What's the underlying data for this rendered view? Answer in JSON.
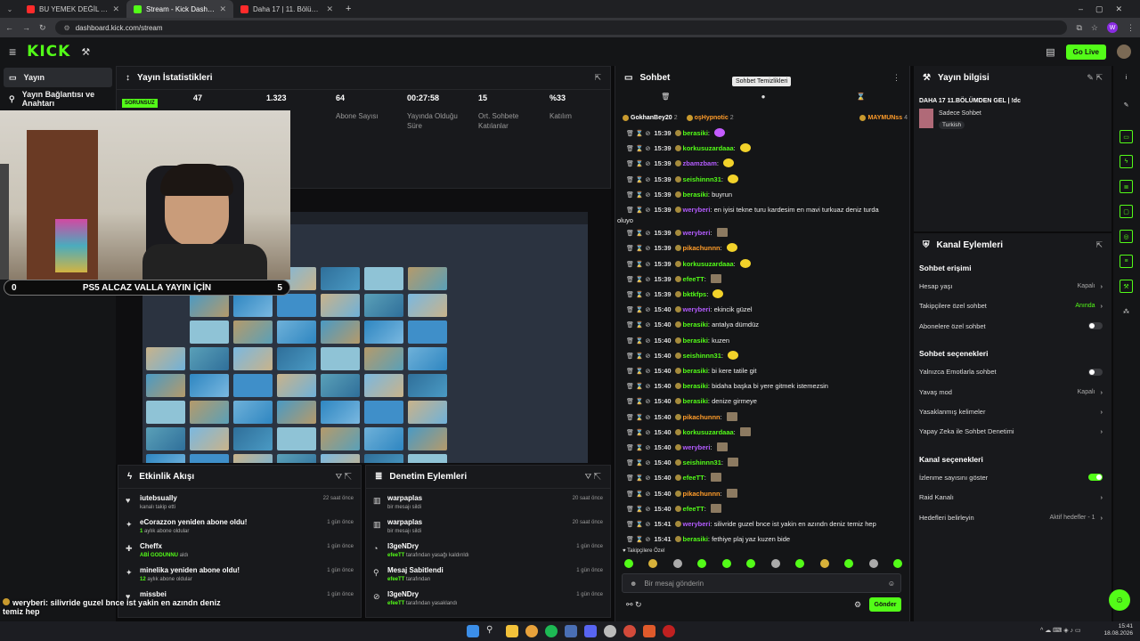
{
  "browser": {
    "tabs": [
      {
        "title": "BU YEMEK DEĞİL ADETA ŞÖLEN",
        "color": "#ff2b2b"
      },
      {
        "title": "Stream - Kick Dashboard",
        "color": "#53fc18"
      },
      {
        "title": "Daha 17 | 11. Bölüm - YouTube",
        "color": "#ff2b2b"
      }
    ],
    "url": "dashboard.kick.com/stream",
    "profile_initial": "W"
  },
  "topbar": {
    "logo": "KICK",
    "golive": "Go Live"
  },
  "sidebar": {
    "items": [
      {
        "label": "Yayın"
      },
      {
        "label": "Yayın Bağlantısı ve Anahtarı"
      }
    ]
  },
  "stats": {
    "title": "Yayın İstatistikleri",
    "status_badge": "SORUNSUZ",
    "items": [
      {
        "value": "47",
        "label": ""
      },
      {
        "value": "1.323",
        "label": ""
      },
      {
        "value": "64",
        "label": "Abone Sayısı"
      },
      {
        "value": "00:27:58",
        "label": "Yayında Olduğu Süre"
      },
      {
        "value": "15",
        "label": "Ort. Sohbete Katılanlar"
      },
      {
        "value": "%33",
        "label": "Katılım"
      }
    ]
  },
  "stream_banner": {
    "left": "0",
    "text": "PS5 ALCAZ VALLA YAYIN İÇİN",
    "right": "5"
  },
  "activity": {
    "title": "Etkinlik Akışı",
    "items": [
      {
        "name": "iutebsually",
        "sub": "kanalı takip etti",
        "time": "22 saat önce",
        "icon": "heart-icon"
      },
      {
        "name": "eCorazzon yeniden abone oldu!",
        "sub_em": "1",
        "sub": " aylık abone oldular",
        "time": "1 gün önce",
        "icon": "star-icon"
      },
      {
        "name": "Cheffx",
        "sub_em": "ABİ GODUNNU",
        "sub": " aldı",
        "time": "1 gün önce",
        "icon": "gift-icon"
      },
      {
        "name": "minelika yeniden abone oldu!",
        "sub_em": "12",
        "sub": " aylık abone oldular",
        "time": "1 gün önce",
        "icon": "star-icon"
      },
      {
        "name": "missbei",
        "sub": "",
        "time": "1 gün önce",
        "icon": "heart-icon"
      }
    ]
  },
  "moderation": {
    "title": "Denetim Eylemleri",
    "items": [
      {
        "name": "warpaplas",
        "sub": "bir mesajı sildi",
        "time": "20 saat önce",
        "icon": "trash-icon"
      },
      {
        "name": "warpaplas",
        "sub": "bir mesajı sildi",
        "time": "20 saat önce",
        "icon": "trash-icon"
      },
      {
        "name": "l3geNDry",
        "sub_em": "efeeTT",
        "sub": " tarafından yasağı kaldırıldı",
        "time": "1 gün önce",
        "icon": "clock-icon"
      },
      {
        "name": "Mesaj Sabitlendi",
        "sub_em": "efeeTT",
        "sub": " tarafından",
        "time": "1 gün önce",
        "icon": "pin-icon"
      },
      {
        "name": "l3geNDry",
        "sub_em": "efeeTT",
        "sub": " tarafından yasaklandı",
        "time": "1 gün önce",
        "icon": "ban-icon"
      }
    ]
  },
  "chat": {
    "title": "Sohbet",
    "tooltip": "Sohbet Temizlikleri",
    "pinned": [
      {
        "name": "GokhanBey20",
        "count": "2"
      },
      {
        "name": "oşHypnotic",
        "count": "2"
      },
      {
        "name": "MAYMUNss",
        "count": "4"
      }
    ],
    "messages": [
      {
        "time": "15:39",
        "user": "berasiki",
        "color": "#53fc18",
        "text": "",
        "emote": "heart"
      },
      {
        "time": "15:39",
        "user": "korkusuzardaaa",
        "color": "#53fc18",
        "text": "",
        "emote": "smile"
      },
      {
        "time": "15:39",
        "user": "zbamzbam",
        "color": "#b45cff",
        "text": "",
        "emote": "smile"
      },
      {
        "time": "15:39",
        "user": "seishinnn31",
        "color": "#53fc18",
        "text": "",
        "emote": "smile"
      },
      {
        "time": "15:39",
        "user": "berasiki",
        "color": "#53fc18",
        "text": "buyrun",
        "emote": ""
      },
      {
        "time": "15:39",
        "user": "weryberi",
        "color": "#b45cff",
        "text": "en iyisi tekne turu kardesim en mavi turkuaz deniz turda",
        "emote": "",
        "wrap": "oluyo"
      },
      {
        "time": "15:39",
        "user": "weryberi",
        "color": "#b45cff",
        "text": "",
        "emote": "img"
      },
      {
        "time": "15:39",
        "user": "pikachunnn",
        "color": "#ff9c2a",
        "text": "",
        "emote": "smile"
      },
      {
        "time": "15:39",
        "user": "korkusuzardaaa",
        "color": "#53fc18",
        "text": "",
        "emote": "smile"
      },
      {
        "time": "15:39",
        "user": "efeeTT",
        "color": "#53fc18",
        "text": "",
        "emote": "img"
      },
      {
        "time": "15:39",
        "user": "bktkfps",
        "color": "#53fc18",
        "text": "",
        "emote": "smile"
      },
      {
        "time": "15:40",
        "user": "weryberi",
        "color": "#b45cff",
        "text": "ekincik güzel",
        "emote": ""
      },
      {
        "time": "15:40",
        "user": "berasiki",
        "color": "#53fc18",
        "text": "antalya dümdüz",
        "emote": ""
      },
      {
        "time": "15:40",
        "user": "berasiki",
        "color": "#53fc18",
        "text": "kuzen",
        "emote": ""
      },
      {
        "time": "15:40",
        "user": "seishinnn31",
        "color": "#53fc18",
        "text": "",
        "emote": "smile"
      },
      {
        "time": "15:40",
        "user": "berasiki",
        "color": "#53fc18",
        "text": "bi kere tatile git",
        "emote": ""
      },
      {
        "time": "15:40",
        "user": "berasiki",
        "color": "#53fc18",
        "text": "bidaha başka bi yere gitmek istemezsin",
        "emote": ""
      },
      {
        "time": "15:40",
        "user": "berasiki",
        "color": "#53fc18",
        "text": "denize girmeye",
        "emote": ""
      },
      {
        "time": "15:40",
        "user": "pikachunnn",
        "color": "#ff9c2a",
        "text": "",
        "emote": "img"
      },
      {
        "time": "15:40",
        "user": "korkusuzardaaa",
        "color": "#53fc18",
        "text": "",
        "emote": "img"
      },
      {
        "time": "15:40",
        "user": "weryberi",
        "color": "#b45cff",
        "text": "",
        "emote": "img"
      },
      {
        "time": "15:40",
        "user": "seishinnn31",
        "color": "#53fc18",
        "text": "",
        "emote": "img"
      },
      {
        "time": "15:40",
        "user": "efeeTT",
        "color": "#53fc18",
        "text": "",
        "emote": "img"
      },
      {
        "time": "15:40",
        "user": "pikachunnn",
        "color": "#ff9c2a",
        "text": "",
        "emote": "img"
      },
      {
        "time": "15:40",
        "user": "efeeTT",
        "color": "#53fc18",
        "text": "",
        "emote": "img"
      },
      {
        "time": "15:41",
        "user": "weryberi",
        "color": "#b45cff",
        "text": "silivride guzel bnce ist yakin en azındn deniz temiz hep",
        "emote": ""
      },
      {
        "time": "15:41",
        "user": "berasiki",
        "color": "#53fc18",
        "text": "fethiye plaj yaz kuzen bide",
        "emote": ""
      }
    ],
    "followers_only": "Takipçilere Özel",
    "input_placeholder": "Bir mesaj gönderin",
    "send": "Gönder"
  },
  "stream_info": {
    "title": "Yayın bilgisi",
    "stream_title": "DAHA 17 11.BÖLÜMDEN GEL | !dc",
    "category": "Sadece Sohbet",
    "tag": "Turkish"
  },
  "channel_actions": {
    "title": "Kanal Eylemleri",
    "chat_access": {
      "heading": "Sohbet erişimi",
      "rows": [
        {
          "label": "Hesap yaşı",
          "value": "Kapalı",
          "green": false,
          "toggle": null
        },
        {
          "label": "Takipçilere özel sohbet",
          "value": "Anında",
          "green": true,
          "toggle": null
        },
        {
          "label": "Abonelere özel sohbet",
          "value": "",
          "green": false,
          "toggle": false
        }
      ]
    },
    "chat_options": {
      "heading": "Sohbet seçenekleri",
      "rows": [
        {
          "label": "Yalnızca Emotlarla sohbet",
          "value": "",
          "green": false,
          "toggle": false
        },
        {
          "label": "Yavaş mod",
          "value": "Kapalı",
          "green": false,
          "toggle": null
        },
        {
          "label": "Yasaklanmış kelimeler",
          "value": "",
          "green": false,
          "toggle": null
        },
        {
          "label": "Yapay Zeka ile Sohbet Denetimi",
          "value": "",
          "green": false,
          "toggle": null
        }
      ]
    },
    "channel_options": {
      "heading": "Kanal seçenekleri",
      "rows": [
        {
          "label": "İzlenme sayısını göster",
          "value": "",
          "green": false,
          "toggle": true
        },
        {
          "label": "Raid Kanalı",
          "value": "",
          "green": false,
          "toggle": null
        },
        {
          "label": "Hedefleri belirleyin",
          "value": "Aktif hedefler - 1",
          "green": false,
          "toggle": null
        }
      ]
    }
  },
  "overlay_chat": [
    {
      "user": "weryberi",
      "text": "silivride guzel bnce ist yakin en azındn deniz",
      "wrap": "temiz hep"
    },
    {
      "user": "berasiki",
      "text": "fethiye plaj yaz kuzen bide",
      "wrap": ""
    }
  ],
  "taskbar": {
    "time": "15:41",
    "date": "18.08.2026"
  }
}
